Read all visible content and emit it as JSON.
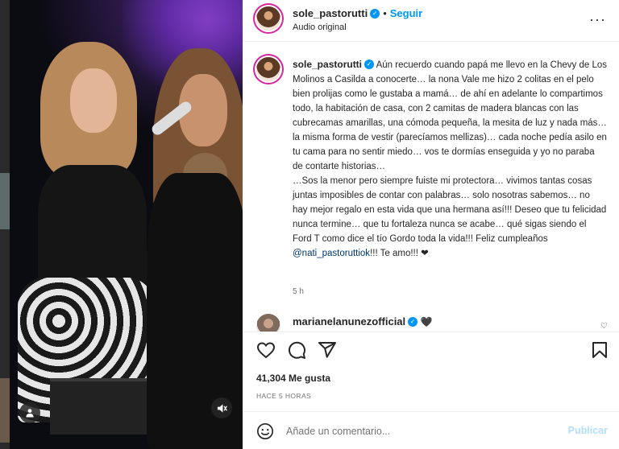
{
  "post": {
    "author": "sole_pastorutti",
    "follow_label": "Seguir",
    "separator": "•",
    "audio_label": "Audio original",
    "more_label": "···"
  },
  "caption": {
    "author": "sole_pastorutti",
    "paragraph_1": "Aún recuerdo cuando papá me llevo en la Chevy de Los Molinos a Casilda a conocerte… la nona Vale me hizo 2 colitas en el pelo bien prolijas como le gustaba a mamá… de ahí en adelante lo compartimos todo, la habitación de casa, con 2 camitas de madera blancas con las cubrecamas amarillas, una cómoda pequeña, la mesita de luz y nada más… la misma forma de vestir (parecíamos mellizas)… cada noche pedía asilo en tu cama para no sentir miedo… vos te dormías enseguida y yo no paraba de contarte historias…",
    "paragraph_2": "…Sos la menor pero siempre fuiste mi protectora… vivimos tantas cosas juntas imposibles de contar con palabras… solo nosotras sabemos… no hay mejor regalo en esta vida que una hermana así!!! Deseo que tu felicidad nunca termine… que tu fortaleza nunca se acabe… qué sigas siendo el Ford T como dice el tío Gordo toda la vida!!! Feliz cumpleaños",
    "mention": "@nati_pastoruttiok",
    "ending": "!!! Te amo!!! ❤",
    "time": "5 h"
  },
  "comment": {
    "author": "marianelanunezofficial",
    "text": "🖤"
  },
  "actions": {
    "likes": "41,304 Me gusta",
    "posted_ago": "HACE 5 HORAS"
  },
  "composer": {
    "placeholder": "Añade un comentario...",
    "post_label": "Publicar"
  },
  "icons": {
    "like": "heart-icon",
    "comment": "comment-icon",
    "share": "send-icon",
    "save": "bookmark-icon",
    "emoji": "emoji-icon",
    "tag": "user-tag-icon",
    "mute": "speaker-muted-icon"
  },
  "colors": {
    "link_blue": "#0095f6",
    "mention_blue": "#00376b",
    "muted_text": "#737373",
    "post_disabled": "#b2dffc"
  }
}
